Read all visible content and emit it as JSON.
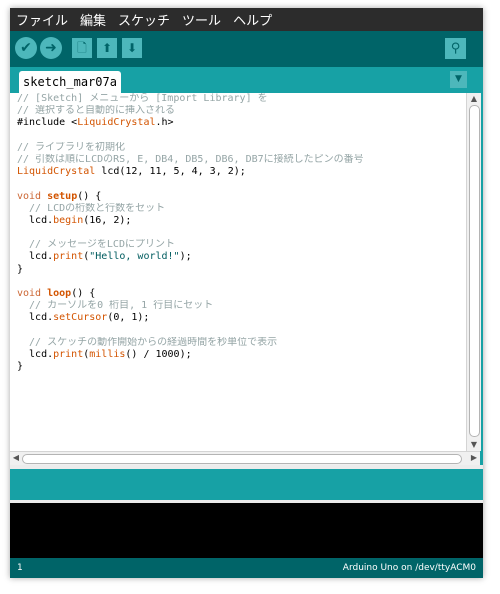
{
  "menu": [
    "ファイル",
    "編集",
    "スケッチ",
    "ツール",
    "ヘルプ"
  ],
  "toolbar": {
    "verify_icon": "✔",
    "upload_icon": "➜",
    "new_icon": "🗋",
    "open_icon": "⬆",
    "save_icon": "⬇",
    "monitor_icon": "⚲"
  },
  "tab": {
    "label": "sketch_mar07a",
    "menu_icon": "▼"
  },
  "code": [
    [
      {
        "t": "// [Sketch] メニューから [Import Library] を",
        "c": "cmt"
      }
    ],
    [
      {
        "t": "// 選択すると自動的に挿入される",
        "c": "cmt"
      }
    ],
    [
      {
        "t": "#include <",
        "c": ""
      },
      {
        "t": "LiquidCrystal",
        "c": "lib"
      },
      {
        "t": ".h>",
        "c": ""
      }
    ],
    [
      {
        "t": "",
        "c": ""
      }
    ],
    [
      {
        "t": "// ライブラリを初期化",
        "c": "cmt"
      }
    ],
    [
      {
        "t": "// 引数は順にLCDのRS, E, DB4, DB5, DB6, DB7に接続したピンの番号",
        "c": "cmt"
      }
    ],
    [
      {
        "t": "LiquidCrystal",
        "c": "lib"
      },
      {
        "t": " lcd(12, 11, 5, 4, 3, 2);",
        "c": ""
      }
    ],
    [
      {
        "t": "",
        "c": ""
      }
    ],
    [
      {
        "t": "void ",
        "c": "kw"
      },
      {
        "t": "setup",
        "c": "fn"
      },
      {
        "t": "() {",
        "c": ""
      }
    ],
    [
      {
        "t": "  // LCDの桁数と行数をセット",
        "c": "cmt"
      }
    ],
    [
      {
        "t": "  lcd.",
        "c": ""
      },
      {
        "t": "begin",
        "c": "lib"
      },
      {
        "t": "(16, 2);",
        "c": ""
      }
    ],
    [
      {
        "t": "",
        "c": ""
      }
    ],
    [
      {
        "t": "  // メッセージをLCDにプリント",
        "c": "cmt"
      }
    ],
    [
      {
        "t": "  lcd.",
        "c": ""
      },
      {
        "t": "print",
        "c": "lib"
      },
      {
        "t": "(",
        "c": ""
      },
      {
        "t": "\"Hello, world!\"",
        "c": "str"
      },
      {
        "t": ");",
        "c": ""
      }
    ],
    [
      {
        "t": "}",
        "c": ""
      }
    ],
    [
      {
        "t": "",
        "c": ""
      }
    ],
    [
      {
        "t": "void ",
        "c": "kw"
      },
      {
        "t": "loop",
        "c": "fn"
      },
      {
        "t": "() {",
        "c": ""
      }
    ],
    [
      {
        "t": "  // カーソルを0 桁目, 1 行目にセット",
        "c": "cmt"
      }
    ],
    [
      {
        "t": "  lcd.",
        "c": ""
      },
      {
        "t": "setCursor",
        "c": "lib"
      },
      {
        "t": "(0, 1);",
        "c": ""
      }
    ],
    [
      {
        "t": "",
        "c": ""
      }
    ],
    [
      {
        "t": "  // スケッチの動作開始からの経過時間を秒単位で表示",
        "c": "cmt"
      }
    ],
    [
      {
        "t": "  lcd.",
        "c": ""
      },
      {
        "t": "print",
        "c": "lib"
      },
      {
        "t": "(",
        "c": ""
      },
      {
        "t": "millis",
        "c": "lib"
      },
      {
        "t": "() / 1000);",
        "c": ""
      }
    ],
    [
      {
        "t": "}",
        "c": ""
      }
    ]
  ],
  "footer": {
    "line": "1",
    "board": "Arduino Uno on /dev/ttyACM0"
  }
}
